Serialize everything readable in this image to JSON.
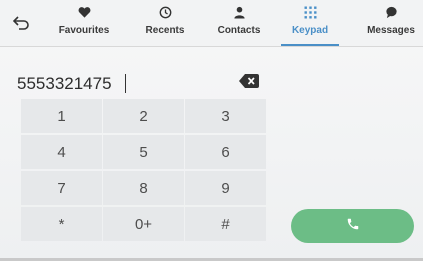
{
  "tabs": [
    {
      "label": "Favourites",
      "icon": "heart-icon"
    },
    {
      "label": "Recents",
      "icon": "clock-icon"
    },
    {
      "label": "Contacts",
      "icon": "person-icon"
    },
    {
      "label": "Keypad",
      "icon": "dialpad-icon",
      "active": true
    },
    {
      "label": "Messages",
      "icon": "chat-bubble-icon"
    }
  ],
  "dial": {
    "number": "5553321475"
  },
  "keypad": [
    "1",
    "2",
    "3",
    "4",
    "5",
    "6",
    "7",
    "8",
    "9",
    "*",
    "0+",
    "#"
  ],
  "colors": {
    "accent": "#4a8fc7",
    "call": "#6cbd86",
    "key_bg": "#e6e8ea"
  },
  "icons": {
    "back": "back-arrow-icon",
    "backspace": "backspace-icon",
    "call": "phone-icon"
  }
}
